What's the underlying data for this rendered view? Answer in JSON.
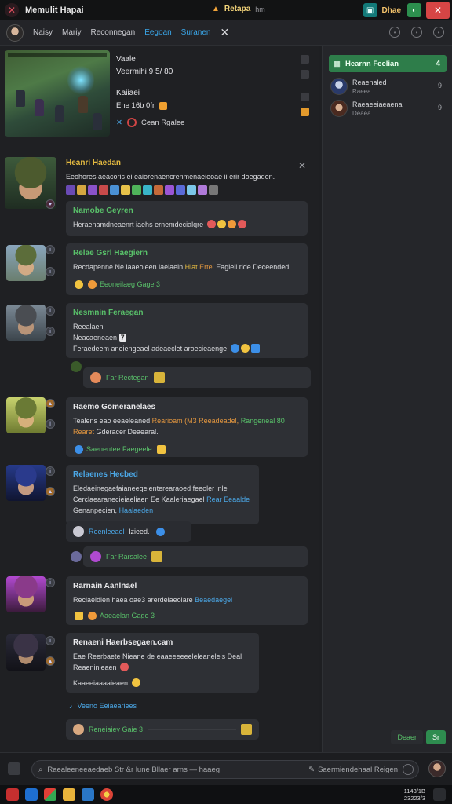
{
  "window": {
    "title": "Memulit Hapai",
    "status_label": "Retapa",
    "status_sub": "hm",
    "right_label": "Dhae"
  },
  "nav": {
    "tabs": [
      {
        "label": "Naisy"
      },
      {
        "label": "Mariy"
      },
      {
        "label": "Reconnegan"
      },
      {
        "label": "Eegoan"
      },
      {
        "label": "Suranen"
      }
    ]
  },
  "video": {
    "title": "Vaale",
    "subtitle": "Veermihi 9 5/ 80",
    "author": "Kaiiaei",
    "meta": "Ene 16b 0fr",
    "tag": "Cean Rgalee"
  },
  "thread": {
    "header_name": "Heanri Haedan",
    "header_text": "Eeohores aeacoris ei eaiorenaencrenmenaeieoae ii erir doegaden."
  },
  "messages": [
    {
      "name": "Namobe Geyren",
      "text": "Heraenamdneaenrt iaehs ernemdecialqre"
    },
    {
      "name": "Relae Gsrl Haegiern",
      "text_a": "Recdapenne Ne iaaeoleen laelaein",
      "text_b": "Hiat",
      "text_c": "Ertel",
      "text_d": "Eagieli ride Deceended",
      "react": "Eeoneilaeg Gage 3"
    },
    {
      "name": "Nesmnin Feraegan",
      "line1": "Reealaen",
      "line2": "Neacaeneaen",
      "line3": "Feraedeem aneiengeael adeaeclet aroecieaenge",
      "react_name": "Far Rectegan"
    },
    {
      "name": "Raemo Gomeranelaes",
      "text_a": "Tealens eao eeaeleaned",
      "text_b": "Rearioam (M3 Reeadeadel,",
      "text_c": "Rangeneal 80",
      "text_d": "Rearet",
      "text_e": "Gderacer Deaearal.",
      "react": "Saenentee Faegeele"
    },
    {
      "name": "Relaenes Hecbed",
      "text_a": "Eledaeinegaefaianeegeienterearaoed feeoler inle",
      "text_b": "Cerclaearanecieiaeliaen Ee Kaaleriaegael",
      "text_c": "Rear Eeaalde",
      "text_d": "Genanpecien,",
      "text_e": "Haalaeden",
      "sub_name": "Reenleeael",
      "sub_text": "lzieed.",
      "react_name": "Far Rarsalee"
    },
    {
      "name": "Rarnain Aanlnael",
      "text_a": "Reclaeidlen haea   oae3 arerdeiaeoiare",
      "text_b": "Beaedaegel",
      "react": "Aaeaelan Gage 3"
    },
    {
      "name": "Renaeni Haerbsegaen.cam",
      "text_a": "Eae Reerbaete Nieane de eaaeeeeeeleleaneleis Deal",
      "text_b": "Reaeninieaen",
      "text_c": "Kaaeeiaaaaieaen",
      "sub": "Veeno Eeiaeariees",
      "react": "Reneiaiey Gaie 3"
    }
  ],
  "right_panel": {
    "active": {
      "name": "Hearnn Feelian",
      "count": "4"
    },
    "items": [
      {
        "name": "Reaenaled",
        "sub": "Raeea",
        "count": "9"
      },
      {
        "name": "Raeaeeiaeaena",
        "sub": "Deaea",
        "count": "9"
      }
    ],
    "ghost_button": "Deaer",
    "primary_button": "Sr"
  },
  "composer": {
    "placeholder": "Raealeeneeaedaeb Str &r lune Bllaer arns — haaeg",
    "right_text": "Saermiendehaal Reigen"
  },
  "taskbar": {
    "time": "1143/1B",
    "date": "23223/3"
  },
  "colors": {
    "accent_green": "#2e7d4a",
    "link_blue": "#4ba7e6",
    "name_yellow": "#e3b940",
    "name_green": "#59c16a",
    "close_red": "#d64545"
  }
}
